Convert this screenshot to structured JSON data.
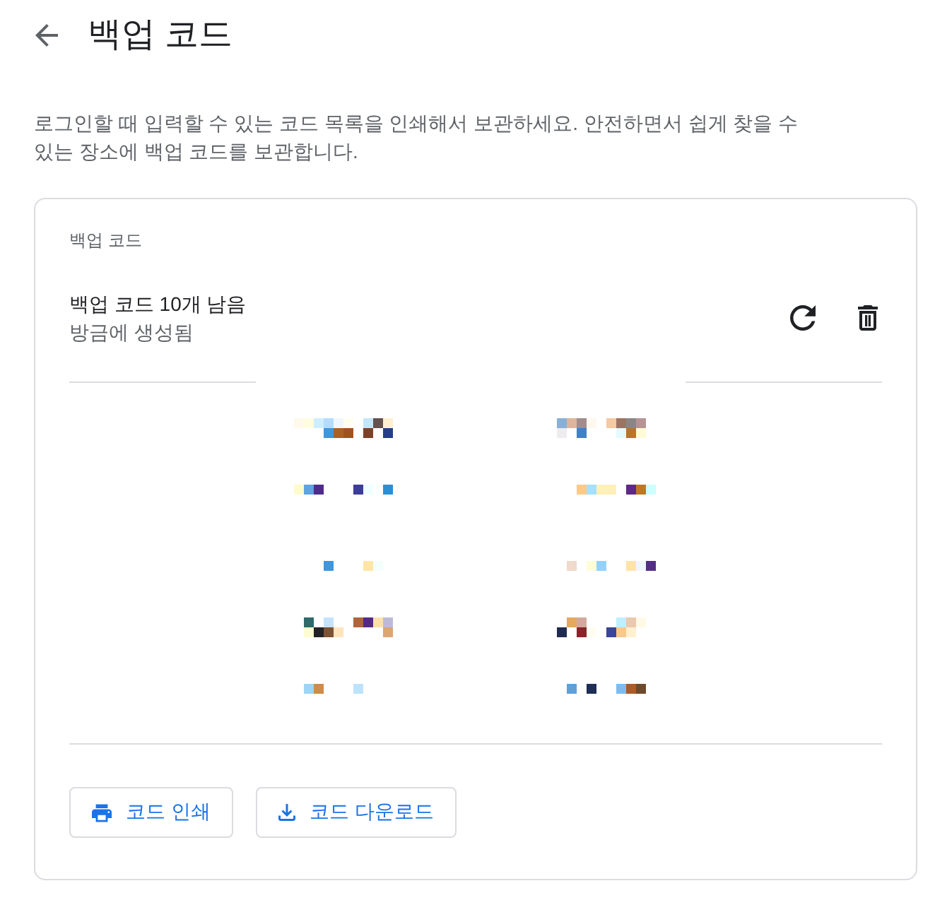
{
  "header": {
    "title": "백업 코드"
  },
  "description": "로그인할 때 입력할 수 있는 코드 목록을 인쇄해서 보관하세요. 안전하면서 쉽게 찾을 수 있는 장소에 백업 코드를 보관합니다.",
  "card": {
    "label": "백업 코드",
    "status": {
      "title": "백업 코드 10개 남음",
      "subtitle": "방금에 생성됨"
    },
    "actions": [
      {
        "kind": "refresh"
      },
      {
        "kind": "delete"
      }
    ],
    "buttons": [
      {
        "kind": "print",
        "label": "코드 인쇄"
      },
      {
        "kind": "download",
        "label": "코드 다운로드"
      }
    ]
  }
}
